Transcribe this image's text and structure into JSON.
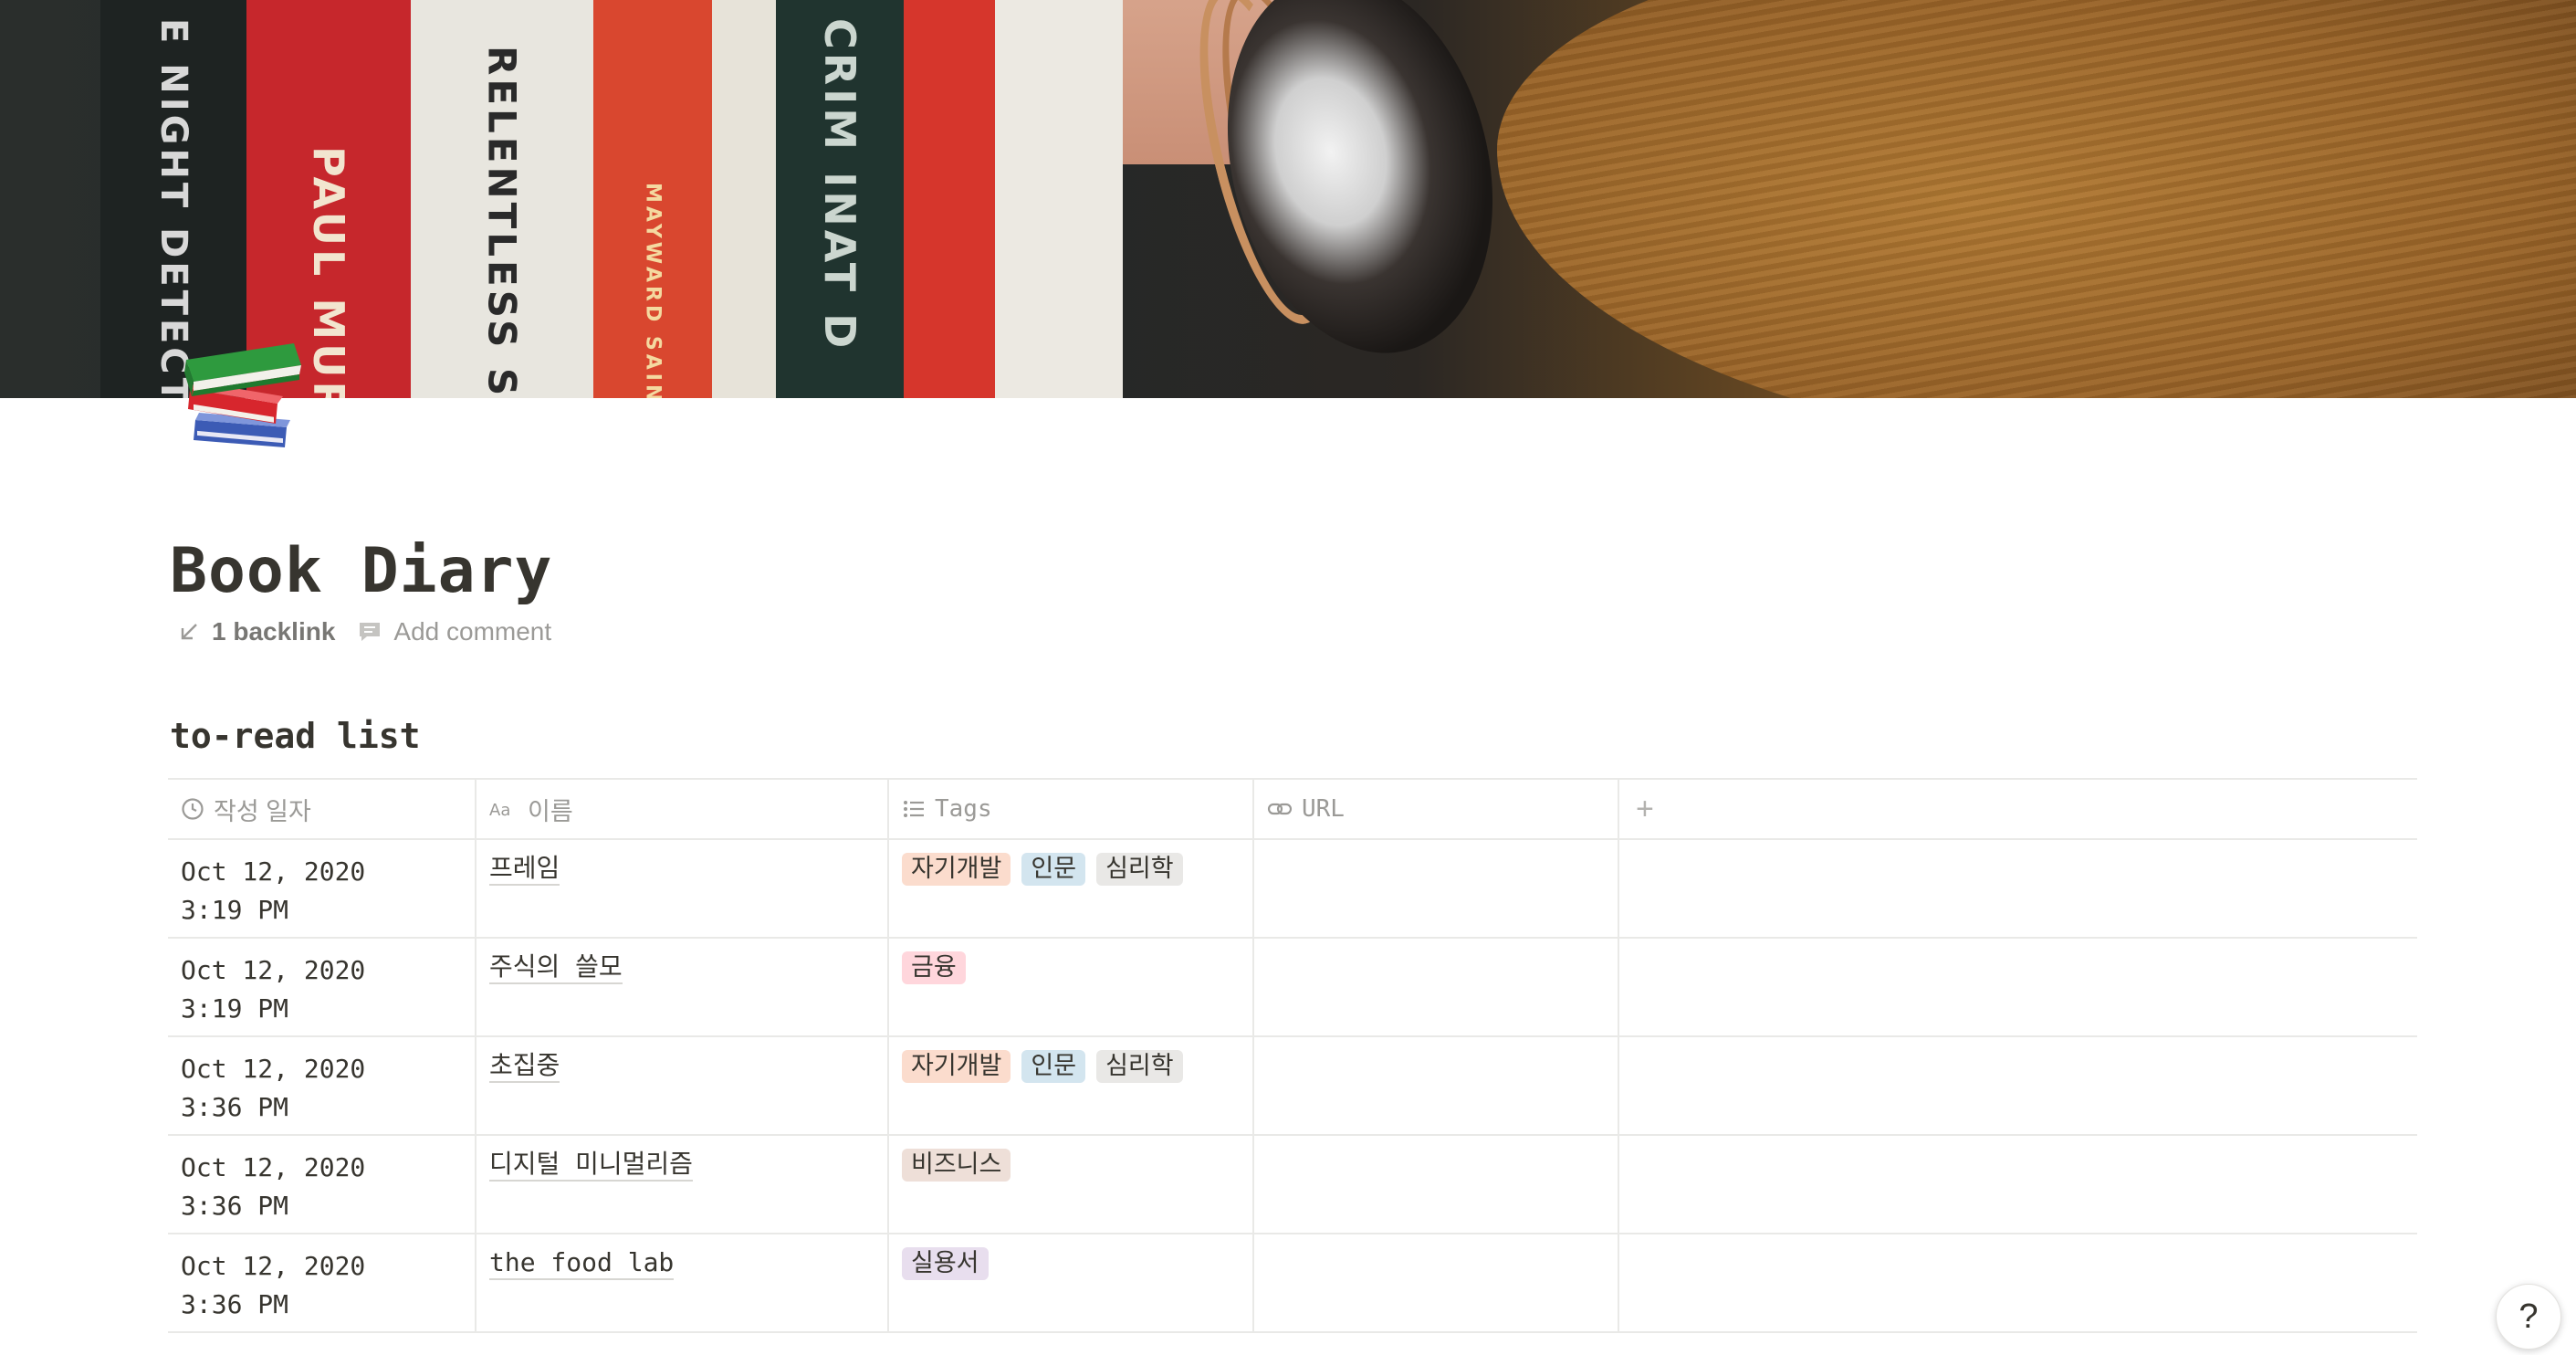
{
  "cover": {
    "spines": [
      {
        "text": "E NIGHT DETECT",
        "bg": "#1e2322",
        "fg": "#d8d8d8"
      },
      {
        "text": "PAUL MUR SKIPPY D",
        "bg": "#c6272c",
        "fg": "#f2e5cf"
      },
      {
        "text": "RELENTLESS STRIKE",
        "bg": "#e8e6df",
        "fg": "#2a2a2a"
      },
      {
        "text": "MAYWARD SAINTS",
        "bg": "#d9472f",
        "fg": "#f4d9a0"
      },
      {
        "text": "",
        "bg": "#e7e3d9",
        "fg": "#555"
      },
      {
        "text": "CRIM INAT D",
        "bg": "#20342f",
        "fg": "#cbd6cf"
      },
      {
        "text": "",
        "bg": "#d6362c",
        "fg": "#fff"
      },
      {
        "text": "",
        "bg": "#ece9e2",
        "fg": "#333"
      }
    ]
  },
  "page": {
    "title": "Book Diary",
    "backlinks": "1 backlink",
    "add_comment": "Add comment"
  },
  "section": {
    "title": "to-read list"
  },
  "table": {
    "columns": [
      {
        "label": "작성 일자",
        "icon": "clock-icon"
      },
      {
        "label": "이름",
        "icon": "title-icon"
      },
      {
        "label": "Tags",
        "icon": "list-icon"
      },
      {
        "label": "URL",
        "icon": "link-icon"
      },
      {
        "label": "+",
        "icon": "add-property-icon"
      }
    ],
    "rows": [
      {
        "date": "Oct 12, 2020\n3:19 PM",
        "name": "프레임",
        "tags": [
          {
            "label": "자기개발",
            "color": "#fbdccd"
          },
          {
            "label": "인문",
            "color": "#d3e5ef"
          },
          {
            "label": "심리학",
            "color": "#e9e8e6"
          }
        ]
      },
      {
        "date": "Oct 12, 2020\n3:19 PM",
        "name": "주식의 쓸모",
        "tags": [
          {
            "label": "금융",
            "color": "#ffd6dc"
          }
        ]
      },
      {
        "date": "Oct 12, 2020\n3:36 PM",
        "name": "초집중",
        "tags": [
          {
            "label": "자기개발",
            "color": "#fbdccd"
          },
          {
            "label": "인문",
            "color": "#d3e5ef"
          },
          {
            "label": "심리학",
            "color": "#e9e8e6"
          }
        ]
      },
      {
        "date": "Oct 12, 2020\n3:36 PM",
        "name": "디지털 미니멀리즘",
        "tags": [
          {
            "label": "비즈니스",
            "color": "#eedfd8"
          }
        ]
      },
      {
        "date": "Oct 12, 2020\n3:36 PM",
        "name": "the food lab",
        "tags": [
          {
            "label": "실용서",
            "color": "#e8deee"
          }
        ]
      }
    ]
  },
  "help": {
    "label": "?"
  }
}
